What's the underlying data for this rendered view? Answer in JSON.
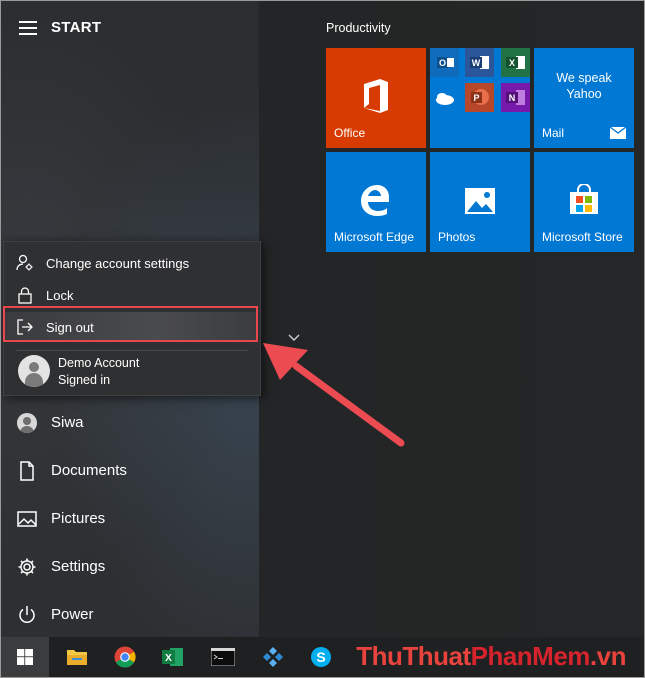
{
  "start_menu": {
    "title": "START",
    "nav": [
      {
        "label": "Siwa",
        "icon": "user-avatar-icon"
      },
      {
        "label": "Documents",
        "icon": "document-icon"
      },
      {
        "label": "Pictures",
        "icon": "picture-icon"
      },
      {
        "label": "Settings",
        "icon": "gear-icon"
      },
      {
        "label": "Power",
        "icon": "power-icon"
      }
    ]
  },
  "account_flyout": {
    "items": [
      {
        "label": "Change account settings",
        "icon": "account-settings-icon"
      },
      {
        "label": "Lock",
        "icon": "lock-icon"
      },
      {
        "label": "Sign out",
        "icon": "sign-out-icon"
      }
    ],
    "account_name": "Demo Account",
    "account_status": "Signed in"
  },
  "tiles": {
    "group_title": "Productivity",
    "office": "Office",
    "mail_line1": "We speak",
    "mail_line2": "Yahoo",
    "mail": "Mail",
    "edge": "Microsoft Edge",
    "photos": "Photos",
    "store": "Microsoft Store"
  },
  "taskbar": {
    "icons": [
      "windows-start-icon",
      "file-explorer-icon",
      "chrome-icon",
      "excel-icon",
      "command-prompt-icon",
      "app-icon",
      "skype-icon"
    ]
  },
  "watermark": {
    "part1": "ThuThuat",
    "part2": "PhanMem",
    "part3": ".vn"
  },
  "colors": {
    "office_tile": "#d83b01",
    "tile_blue": "#0078d4",
    "highlight_border": "#e8474f",
    "arrow": "#ec4b52"
  }
}
